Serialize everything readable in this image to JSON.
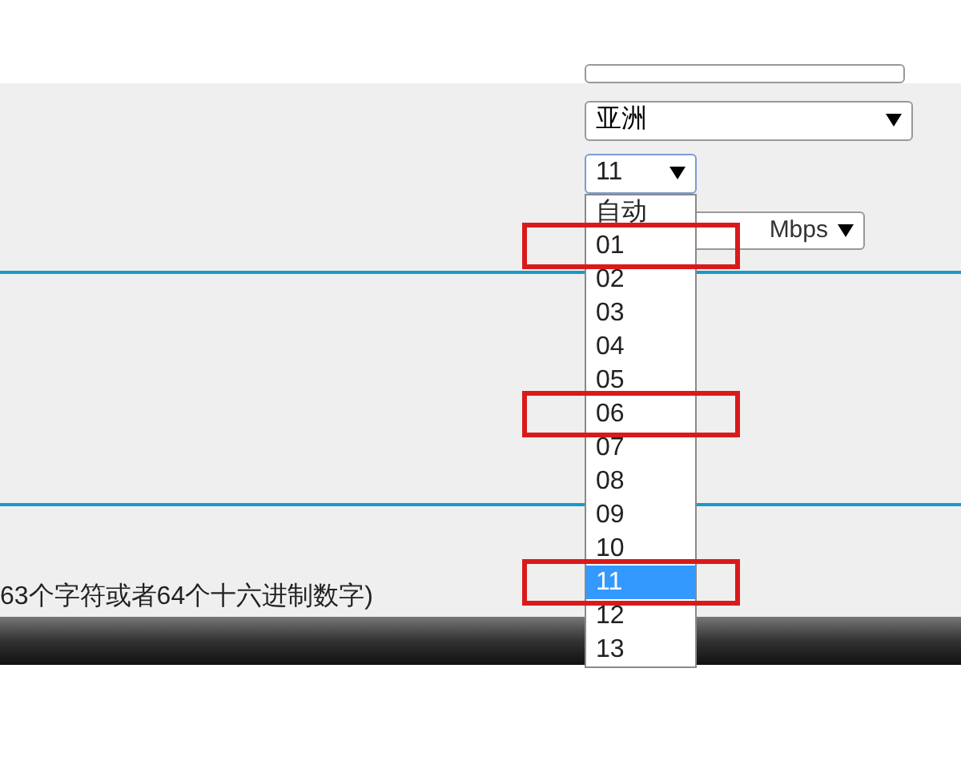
{
  "region_select": {
    "value": "亚洲"
  },
  "channel_select": {
    "value": "11",
    "expanded": true,
    "options": [
      {
        "label": "自动",
        "selected": false,
        "highlighted": false
      },
      {
        "label": "01",
        "selected": false,
        "highlighted": true
      },
      {
        "label": "02",
        "selected": false,
        "highlighted": false
      },
      {
        "label": "03",
        "selected": false,
        "highlighted": false
      },
      {
        "label": "04",
        "selected": false,
        "highlighted": false
      },
      {
        "label": "05",
        "selected": false,
        "highlighted": false
      },
      {
        "label": "06",
        "selected": false,
        "highlighted": true
      },
      {
        "label": "07",
        "selected": false,
        "highlighted": false
      },
      {
        "label": "08",
        "selected": false,
        "highlighted": false
      },
      {
        "label": "09",
        "selected": false,
        "highlighted": false
      },
      {
        "label": "10",
        "selected": false,
        "highlighted": false
      },
      {
        "label": "11",
        "selected": true,
        "highlighted": true
      },
      {
        "label": "12",
        "selected": false,
        "highlighted": false
      },
      {
        "label": "13",
        "selected": false,
        "highlighted": false
      }
    ]
  },
  "rate_select": {
    "value": "Mbps"
  },
  "key_hint": "63个字符或者64个十六进制数字)"
}
